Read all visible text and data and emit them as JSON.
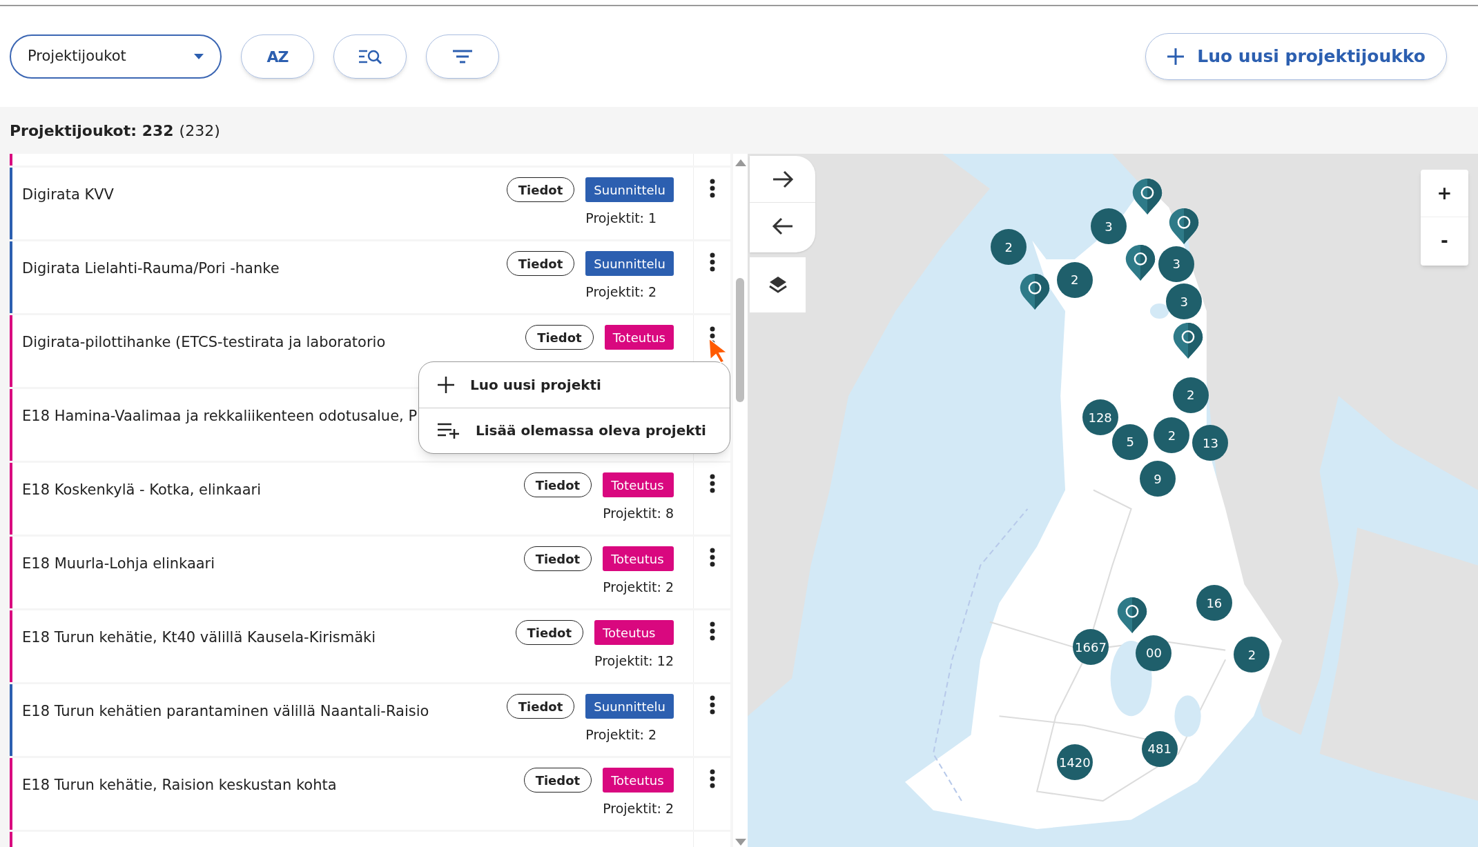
{
  "toolbar": {
    "view_select": {
      "value": "Projektijoukot"
    },
    "sort_button": {
      "label": "AZ"
    },
    "create_button": {
      "label": "Luo uusi projektijoukko"
    }
  },
  "summary": {
    "label": "Projektijoukot:",
    "count": "232",
    "total": "(232)"
  },
  "rows": [
    {
      "color": "#d9087f"
    },
    {
      "name": "Digirata KVV",
      "info": "Tiedot",
      "color": "#2c5fb0",
      "phase_label": "Suunnittelu",
      "projects": "Projektit: 1",
      "more": true,
      "menu_open": false
    },
    {
      "name": "Digirata Lielahti-Rauma/Pori -hanke",
      "info": "Tiedot",
      "color": "#2c5fb0",
      "phase_label": "Suunnittelu",
      "projects": "Projektit: 2",
      "more": true,
      "menu_open": false
    },
    {
      "name": "Digirata-pilottihanke (ETCS-testirata ja laboratorio",
      "info": "Tiedot",
      "color": "#d9087f",
      "phase_label": "Toteutus",
      "more": true,
      "menu_open": true
    },
    {
      "name": "E18 Hamina-Vaalimaa ja rekkaliikenteen odotusalue, P",
      "color": "#d9087f",
      "menu_open": false
    },
    {
      "name": "E18 Koskenkylä - Kotka, elinkaari",
      "info": "Tiedot",
      "color": "#d9087f",
      "phase_label": "Toteutus",
      "projects": "Projektit: 8",
      "more": true,
      "menu_open": false
    },
    {
      "name": "E18 Muurla-Lohja elinkaari",
      "info": "Tiedot",
      "color": "#d9087f",
      "phase_label": "Toteutus",
      "projects": "Projektit: 2",
      "more": true,
      "menu_open": false
    },
    {
      "name": "E18 Turun kehätie, Kt40 välillä Kausela-Kirismäki",
      "info": "Tiedot",
      "color": "#d9087f",
      "phase_label": "Toteutus",
      "projects": "Projektit: 12",
      "more": true,
      "menu_open": false
    },
    {
      "name": "E18 Turun kehätien parantaminen välillä Naantali-Raisio",
      "info": "Tiedot",
      "color": "#2c5fb0",
      "phase_label": "Suunnittelu",
      "projects": "Projektit: 2",
      "more": true,
      "menu_open": false
    },
    {
      "name": "E18 Turun kehätie, Raision keskustan kohta",
      "info": "Tiedot",
      "color": "#d9087f",
      "phase_label": "Toteutus",
      "projects": "Projektit: 2",
      "more": true,
      "menu_open": false
    },
    {
      "color": "#d9087f"
    }
  ],
  "context_menu": {
    "items": [
      {
        "kind": "new",
        "label": "Luo uusi projekti"
      },
      {
        "kind": "add",
        "label": "Lisää olemassa oleva projekti"
      }
    ]
  },
  "map": {
    "markers": [
      {
        "kind": "pin"
      },
      {
        "kind": "pin"
      },
      {
        "kind": "pin"
      },
      {
        "kind": "pin"
      },
      {
        "kind": "pin"
      },
      {
        "kind": "pin"
      },
      {
        "kind": "cluster",
        "label": "2"
      },
      {
        "kind": "cluster",
        "label": "3"
      },
      {
        "kind": "cluster",
        "label": "2"
      },
      {
        "kind": "cluster",
        "label": "3"
      },
      {
        "kind": "cluster",
        "label": "3"
      },
      {
        "kind": "cluster",
        "label": "2"
      },
      {
        "kind": "cluster",
        "label": "128"
      },
      {
        "kind": "cluster",
        "label": "5"
      },
      {
        "kind": "cluster",
        "label": "2"
      },
      {
        "kind": "cluster",
        "label": "13"
      },
      {
        "kind": "cluster",
        "label": "9"
      },
      {
        "kind": "cluster",
        "label": "16"
      },
      {
        "kind": "cluster",
        "label": "1667"
      },
      {
        "kind": "cluster",
        "label": "00"
      },
      {
        "kind": "cluster",
        "label": "2"
      },
      {
        "kind": "cluster",
        "label": "481"
      },
      {
        "kind": "cluster",
        "label": "1420"
      }
    ],
    "zoom_in": "+",
    "zoom_out": "-"
  }
}
